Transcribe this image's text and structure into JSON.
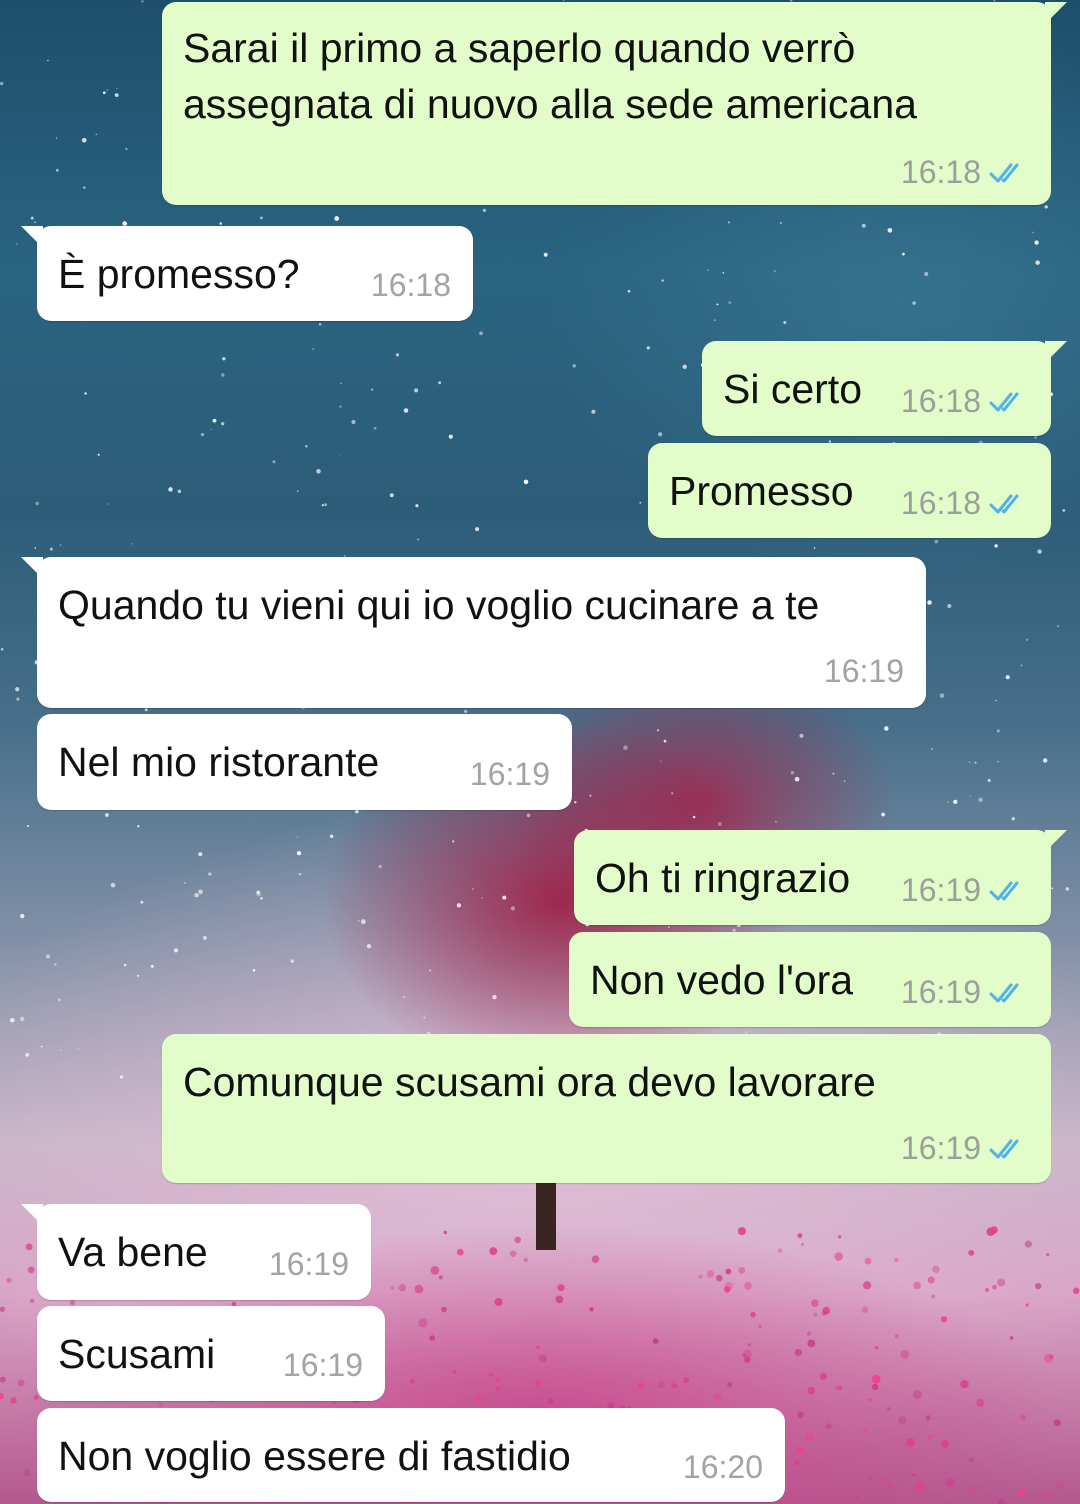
{
  "messages": [
    {
      "dir": "out",
      "text": "Sarai il primo a saperlo quando verrò assegnata di nuovo alla sede americana",
      "time": "16:18",
      "status": "read"
    },
    {
      "dir": "in",
      "text": "È promesso?",
      "time": "16:18"
    },
    {
      "dir": "out",
      "text": "Si certo",
      "time": "16:18",
      "status": "read"
    },
    {
      "dir": "out",
      "text": "Promesso",
      "time": "16:18",
      "status": "read"
    },
    {
      "dir": "in",
      "text": "Quando tu vieni qui io voglio cucinare a te",
      "time": "16:19"
    },
    {
      "dir": "in",
      "text": "Nel mio ristorante",
      "time": "16:19"
    },
    {
      "dir": "out",
      "text": "Oh ti ringrazio",
      "time": "16:19",
      "status": "read"
    },
    {
      "dir": "out",
      "text": "Non vedo l'ora",
      "time": "16:19",
      "status": "read"
    },
    {
      "dir": "out",
      "text": "Comunque scusami ora devo lavorare",
      "time": "16:19",
      "status": "read"
    },
    {
      "dir": "in",
      "text": "Va bene",
      "time": "16:19"
    },
    {
      "dir": "in",
      "text": "Scusami",
      "time": "16:19"
    },
    {
      "dir": "in",
      "text": "Non voglio essere di fastidio",
      "time": "16:20"
    }
  ],
  "colors": {
    "incoming_bubble": "#ffffff",
    "outgoing_bubble": "#e2fdc9",
    "read_ticks": "#4fb3e8",
    "timestamp": "#9aa09a"
  },
  "icons": {
    "read_status": "double-check-icon"
  }
}
